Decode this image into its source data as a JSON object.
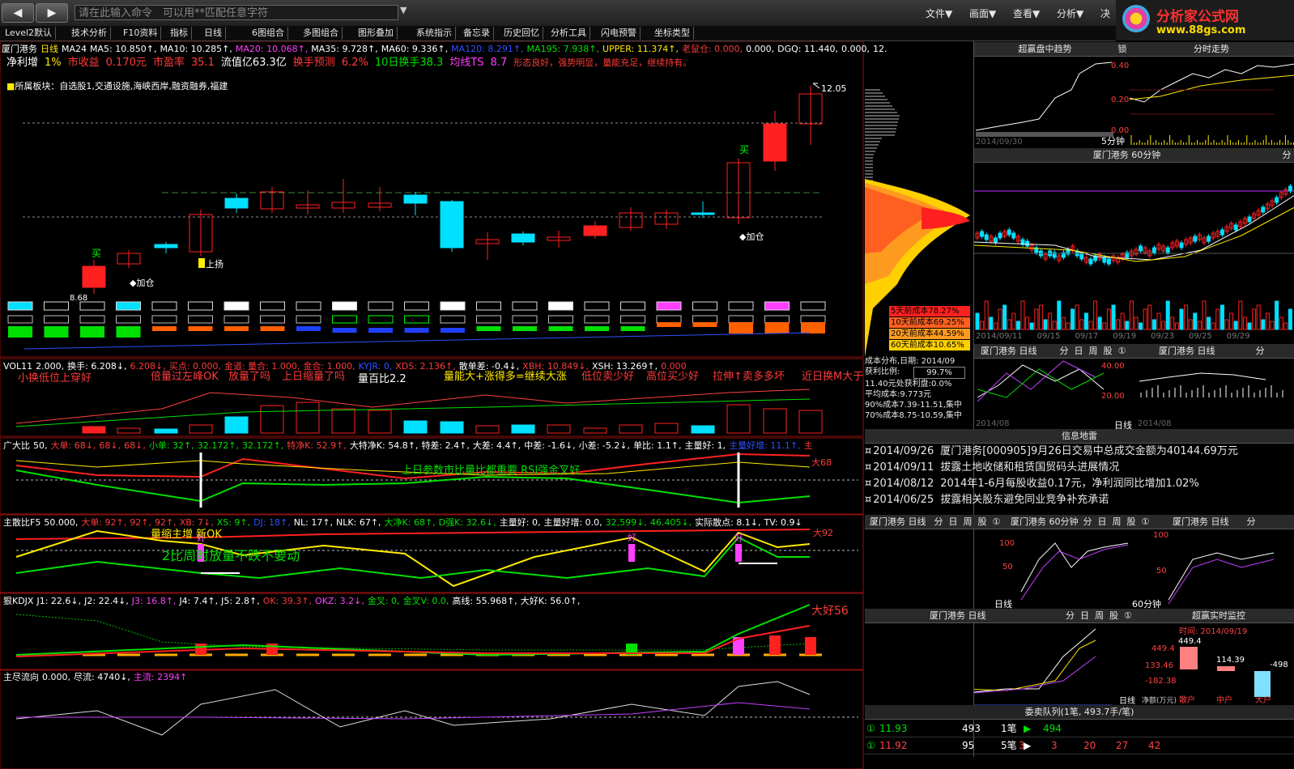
{
  "topbar": {
    "back_label": "◀",
    "forward_label": "▶",
    "command_placeholder": "请在此输入命令　可以用**匹配任意字符",
    "menus": [
      "文件▼",
      "画面▼",
      "查看▼",
      "分析▼",
      "决"
    ],
    "logo_title": "分析家公式网",
    "logo_url_text": "www.88gs.com"
  },
  "toolbar": [
    "Level2默认",
    "技术分析",
    "F10资料",
    "指标",
    "日线",
    "6图组合",
    "多图组合",
    "图形叠加",
    "系统指示",
    "备忘录",
    "历史回忆",
    "分析工具",
    "闪电预警",
    "坐标类型"
  ],
  "main": {
    "header_line": [
      "厦门港务",
      "日线",
      "MA24",
      "MA5: 10.850↑,",
      "MA10: 10.285↑,",
      "MA20: 10.068↑,",
      "MA35: 9.728↑,",
      "MA60: 9.336↑,",
      "MA120: 8.291↑,",
      "MA195: 7.938↑,",
      "UPPER: 11.374↑,",
      "老鼠仓: 0.000,",
      "0.000,",
      "DGQ: 11.440,",
      "0.000,",
      "12."
    ],
    "stats": [
      "净利增",
      "1%",
      "市收益",
      "0.170元",
      "市盈率",
      "35.1",
      "流值亿63.3亿",
      "换手预测",
      "6.2%",
      "10日换手38.3",
      "均线TS",
      "8.7",
      "形态良好，强势明显，量能充足，继续持有。"
    ],
    "sector": "所属板块：自选股1,交通设施,海峡西岸,融资融券,福建",
    "price_high_label": "12.05",
    "low_label": "8.68",
    "buy_marks": [
      "买",
      "买"
    ],
    "add_marks": [
      "加仓",
      "加仓"
    ],
    "up_mark": "上扬"
  },
  "vol": {
    "header": [
      "VOL11",
      "2.000,",
      "换手: 6.208↓,",
      "6.208↓,",
      "买点: 0.000,",
      "金道: 量合: 1.000,",
      "金合: 1.000,",
      "KYJR: 0,",
      "XDS: 2.136↑,",
      "散单差: -0.4↓,",
      "XBH: 10.849↓,",
      "XSH: 13.269↑,",
      "0.000"
    ],
    "notes": [
      "小换低位上穿好",
      "倍量过左峰OK",
      "放量了吗",
      "上日缩量了吗",
      "量百比2.2",
      "量能大+涨得多=继续大涨",
      "低位卖少好",
      "高位买少好",
      "拉伸↑卖多多坏",
      "近日换M大于"
    ]
  },
  "big": {
    "header": [
      "广大比",
      "50,",
      "大单: 68↓,",
      "68↓,",
      "68↓,",
      "小单: 32↑,",
      "32.172↑,",
      "32.172↑,",
      "特净K: 52.9↑,",
      "大特净K: 54.8↑,",
      "特差: 2.4↑,",
      "大差: 4.4↑,",
      "中差: -1.6↓,",
      "小差: -5.2↓,",
      "单比: 1.1↑,",
      "主量好: 1,",
      "主量好增: 11.1↑,",
      "主"
    ],
    "note": "上日参数市比量比都重要 RSI强金叉好",
    "tag": "大68"
  },
  "main3": {
    "header": [
      "主散比F5",
      "50.000,",
      "大单: 92↑,",
      "92↑,",
      "92↑,",
      "XB: 7↓,",
      "XS: 9↑,",
      "DJ: 18↑,",
      "NL: 17↑,",
      "NLK: 67↑,",
      "大净K: 68↑,",
      "D强K: 32.6↓,",
      "主量好: 0,",
      "主量好增: 0.0,",
      "32,599↓,",
      "46.405↓,",
      "实际散点: 8.1↓,",
      "TV: 0.9↓"
    ],
    "note1": "量缩主增 新OK",
    "note2": "2比周时放量不跌不要动",
    "tag": "大92",
    "good": [
      "好",
      "好",
      "好"
    ]
  },
  "kdj": {
    "header": [
      "狠KDJX",
      "J1: 22.6↓,",
      "J2: 22.4↓,",
      "J3: 16.8↑,",
      "J4: 7.4↑,",
      "J5: 2.8↑,",
      "OK: 39.3↑,",
      "OKZ: 3.2↓,",
      "金叉: 0,",
      "金叉V: 0.0,",
      "高线: 55.968↑,",
      "大好K: 56.0↑,"
    ],
    "tag": "大好56"
  },
  "flow": {
    "header": [
      "主尽流向",
      "0.000,",
      "尽流: 4740↓,",
      "主流: 2394↑"
    ]
  },
  "chip": {
    "legend": [
      "5天前成本78.27%",
      "10天前成本69.25%",
      "20天前成本44.59%",
      "60天前成本10.65%"
    ],
    "legend_colors": [
      "#ff2020",
      "#ff6020",
      "#ff9a20",
      "#ffd000"
    ],
    "info": [
      "成本分布,日期: 2014/09",
      "获利比例:",
      "99.7%",
      "11.40元处获利盘:0.0%",
      "平均成本:9.773元",
      "90%成本7.39-11.51,集中",
      "70%成本8.75-10.59,集中"
    ]
  },
  "right": {
    "chaoying_title": "超赢盘中趋势",
    "lock_label": "锁",
    "intraday_title": "分时走势",
    "five_min": "5分钟",
    "date_1": "2014/09/30",
    "yaxis_right": [
      "0.40",
      "0.20",
      "0.00"
    ],
    "h60_title": "厦门港务 60分钟",
    "fen_label": "分",
    "dates_60": [
      "2014/09/11",
      "09/15",
      "09/17",
      "09/19",
      "09/23",
      "09/25",
      "09/29"
    ],
    "pane_tabs": [
      "分",
      "日",
      "周",
      "股",
      "①"
    ],
    "small_title": "厦门港务 日线",
    "day_label": "日线",
    "date_small": "2014/08",
    "ticks_small": [
      "40.00",
      "20.00"
    ],
    "news_title": "信息地雷",
    "news": [
      {
        "date": "2014/09/26",
        "text": "厦门港务[000905]9月26日交易中总成交金额为40144.69万元"
      },
      {
        "date": "2014/09/11",
        "text": "拔露土地收储和租赁国贸码头进展情况"
      },
      {
        "date": "2014/08/12",
        "text": "2014年1-6月每股收益0.17元，净利润同比增加1.02%"
      },
      {
        "date": "2014/06/25",
        "text": "拔露相关股东避免同业竞争补充承诺"
      }
    ],
    "lower_titles": [
      "厦门港务 日线",
      "厦门港务 60分钟",
      "厦门港务 日线"
    ],
    "ticks_100": [
      "100",
      "50"
    ],
    "label_60": "60分钟",
    "bottom_title": "厦门港务 日线",
    "realtime_title": "超赢实时监控",
    "realtime_time": "时间: 2014/09/19",
    "realtime_vals": [
      "449.4",
      "449.4",
      "114.39",
      "133.46",
      "-182.38",
      "-498"
    ],
    "realtime_labels": [
      "散户",
      "中户",
      "大户"
    ],
    "jing_label": "净额(万元)",
    "queue_title": "委卖队列(1笔, 493.7手/笔)",
    "queue": [
      {
        "price": "11.93",
        "vol": "493",
        "count": "1笔",
        "arrow": "▶",
        "val": "494",
        "extra": []
      },
      {
        "price": "11.92",
        "vol": "95",
        "count": "5笔",
        "arrow": "▶",
        "val": "",
        "extra": [
          "3",
          "3",
          "20",
          "27",
          "42"
        ]
      }
    ]
  }
}
